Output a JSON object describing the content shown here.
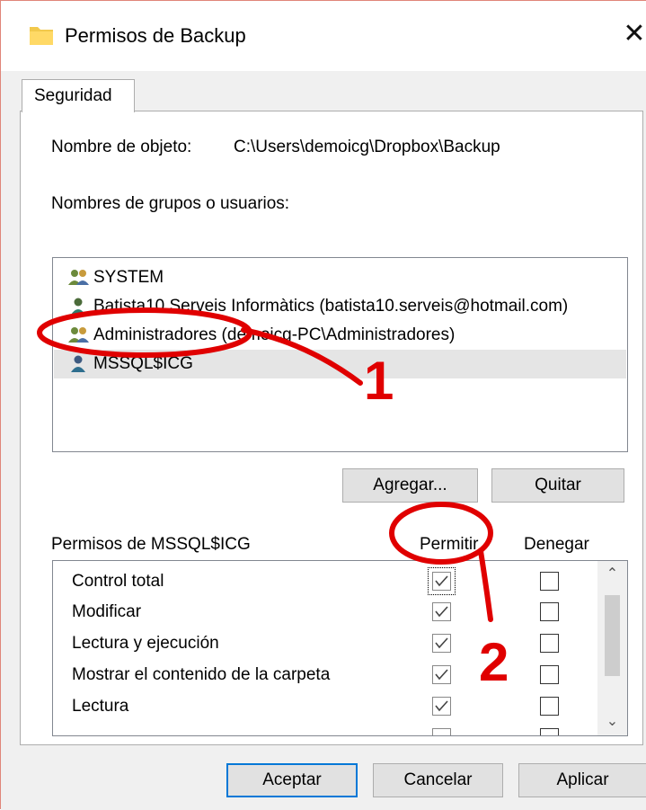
{
  "window": {
    "title": "Permisos de Backup",
    "close_glyph": "✕",
    "icon": "folder-icon"
  },
  "tabs": [
    {
      "label": "Seguridad"
    }
  ],
  "object": {
    "label": "Nombre de objeto:",
    "value": "C:\\Users\\demoicg\\Dropbox\\Backup"
  },
  "groups": {
    "label": "Nombres de grupos o usuarios:",
    "items": [
      {
        "label": "SYSTEM",
        "icon": "group-users-icon"
      },
      {
        "label": "Batista10 Serveis Informàtics (batista10.serveis@hotmail.com)",
        "icon": "user-icon"
      },
      {
        "label": "Administradores (demoicg-PC\\Administradores)",
        "icon": "group-users-icon"
      },
      {
        "label": "MSSQL$ICG",
        "icon": "user-icon",
        "selected": true
      }
    ]
  },
  "buttons": {
    "add": "Agregar...",
    "remove": "Quitar",
    "ok": "Aceptar",
    "cancel": "Cancelar",
    "apply": "Aplicar"
  },
  "permissions": {
    "label": "Permisos de MSSQL$ICG",
    "allow_header": "Permitir",
    "deny_header": "Denegar",
    "rows": [
      {
        "name": "Control total",
        "allow": true,
        "deny": false
      },
      {
        "name": "Modificar",
        "allow": true,
        "deny": false
      },
      {
        "name": "Lectura y ejecución",
        "allow": true,
        "deny": false
      },
      {
        "name": "Mostrar el contenido de la carpeta",
        "allow": true,
        "deny": false
      },
      {
        "name": "Lectura",
        "allow": true,
        "deny": false
      }
    ]
  },
  "annotations": {
    "marker_1": "1",
    "marker_2": "2",
    "color": "#e00000"
  },
  "colors": {
    "accent": "#0078d7",
    "selection": "#e5e5e5",
    "dialog_bg": "#f0f0f0"
  }
}
